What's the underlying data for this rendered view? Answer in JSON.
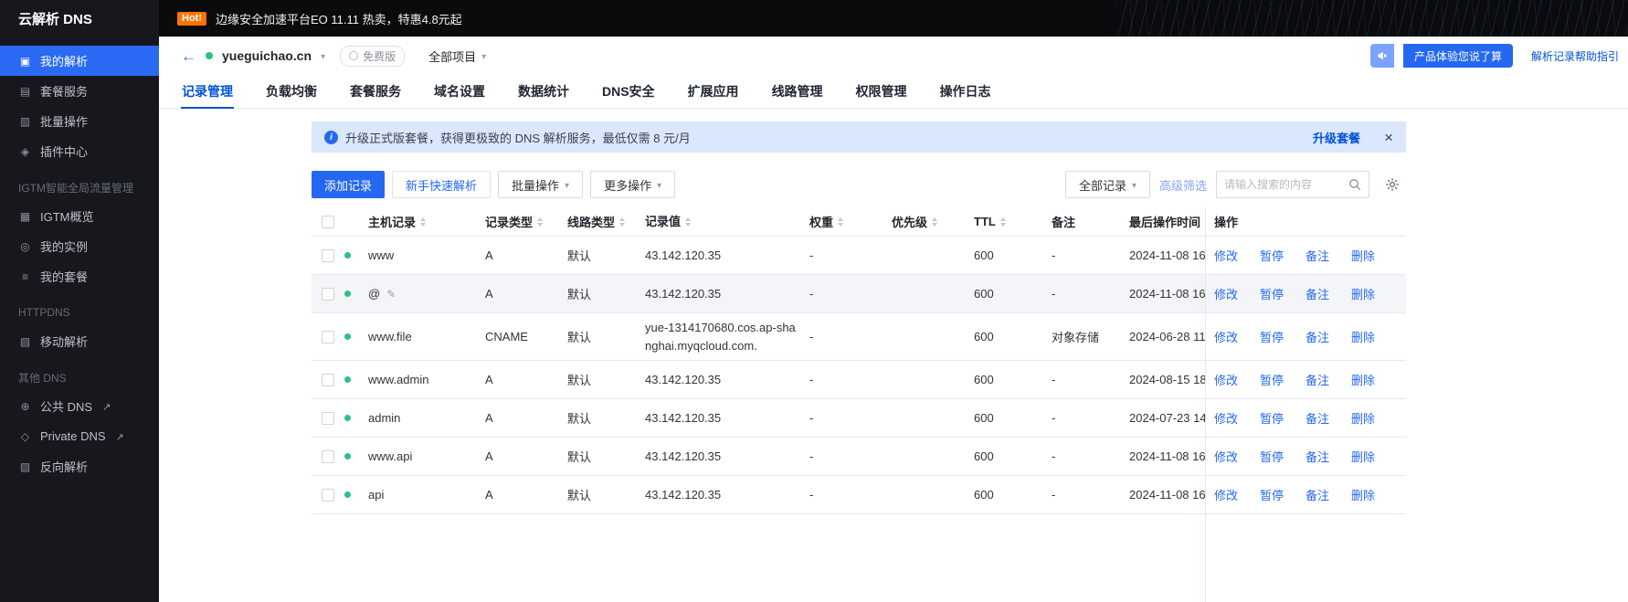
{
  "colors": {
    "accent": "#2468f2",
    "accent_dark": "#0052d9",
    "sidebar_bg": "#17181d",
    "topbar_bg": "#0a0b0d",
    "hot_badge": "#ff7200",
    "banner_bg": "#dbe7fc",
    "status_green": "#2bc27d",
    "hover_row": "#f3f5f8",
    "border": "#e8eaee"
  },
  "sidebar": {
    "title": "云解析 DNS",
    "items": [
      {
        "label": "我的解析",
        "icon": "monitor",
        "active": true
      },
      {
        "label": "套餐服务",
        "icon": "package"
      },
      {
        "label": "批量操作",
        "icon": "batch"
      },
      {
        "label": "插件中心",
        "icon": "plugin"
      },
      {
        "label": "IGTM智能全局流量管理",
        "section": true
      },
      {
        "label": "IGTM概览",
        "icon": "overview"
      },
      {
        "label": "我的实例",
        "icon": "instance"
      },
      {
        "label": "我的套餐",
        "icon": "plan"
      },
      {
        "label": "HTTPDNS",
        "section": true
      },
      {
        "label": "移动解析",
        "icon": "mobile"
      },
      {
        "label": "其他 DNS",
        "section": true
      },
      {
        "label": "公共 DNS",
        "icon": "globe",
        "external": true
      },
      {
        "label": "Private DNS",
        "icon": "private",
        "external": true
      },
      {
        "label": "反向解析",
        "icon": "reverse"
      }
    ]
  },
  "topbar": {
    "hot_badge": "Hot!",
    "promo_text": "边缘安全加速平台EO 11.11 热卖，特惠4.8元起"
  },
  "header": {
    "domain": "yueguichao.cn",
    "plan_badge": "免费版",
    "project_selector": "全部项目",
    "feedback_button": "产品体验您说了算",
    "help_link": "解析记录帮助指引"
  },
  "tabs": [
    {
      "label": "记录管理",
      "active": true
    },
    {
      "label": "负载均衡"
    },
    {
      "label": "套餐服务"
    },
    {
      "label": "域名设置"
    },
    {
      "label": "数据统计"
    },
    {
      "label": "DNS安全"
    },
    {
      "label": "扩展应用"
    },
    {
      "label": "线路管理"
    },
    {
      "label": "权限管理"
    },
    {
      "label": "操作日志"
    }
  ],
  "banner": {
    "text": "升级正式版套餐，获得更极致的 DNS 解析服务，最低仅需 8 元/月",
    "action": "升级套餐"
  },
  "toolbar": {
    "add_record": "添加记录",
    "quick_setup": "新手快速解析",
    "batch_ops": "批量操作",
    "more_ops": "更多操作",
    "filter_all": "全部记录",
    "advanced_filter": "高级筛选",
    "search_placeholder": "请输入搜索的内容"
  },
  "table": {
    "columns": [
      {
        "label": "主机记录",
        "sortable": true
      },
      {
        "label": "记录类型",
        "sortable": true
      },
      {
        "label": "线路类型",
        "sortable": true
      },
      {
        "label": "记录值",
        "sortable": true
      },
      {
        "label": "权重",
        "sortable": true
      },
      {
        "label": "优先级",
        "sortable": true
      },
      {
        "label": "TTL",
        "sortable": true
      },
      {
        "label": "备注",
        "sortable": false
      },
      {
        "label": "最后操作时间",
        "sortable": true
      },
      {
        "label": "操作",
        "sortable": false
      }
    ],
    "actions": [
      "修改",
      "暂停",
      "备注",
      "删除"
    ],
    "rows": [
      {
        "status": "enabled",
        "host": "www",
        "type": "A",
        "line": "默认",
        "value": "43.142.120.35",
        "weight": "-",
        "priority": "",
        "ttl": "600",
        "remark": "-",
        "updated": "2024-11-08 16:"
      },
      {
        "status": "enabled",
        "host": "@",
        "editable": true,
        "hover": true,
        "type": "A",
        "line": "默认",
        "value": "43.142.120.35",
        "weight": "-",
        "priority": "",
        "ttl": "600",
        "remark": "-",
        "updated": "2024-11-08 16:"
      },
      {
        "status": "enabled",
        "host": "www.file",
        "type": "CNAME",
        "line": "默认",
        "value": "yue-1314170680.cos.ap-shanghai.myqcloud.com.",
        "weight": "-",
        "priority": "",
        "ttl": "600",
        "remark": "对象存储",
        "updated": "2024-06-28 11:"
      },
      {
        "status": "enabled",
        "host": "www.admin",
        "type": "A",
        "line": "默认",
        "value": "43.142.120.35",
        "weight": "-",
        "priority": "",
        "ttl": "600",
        "remark": "-",
        "updated": "2024-08-15 18:"
      },
      {
        "status": "enabled",
        "host": "admin",
        "type": "A",
        "line": "默认",
        "value": "43.142.120.35",
        "weight": "-",
        "priority": "",
        "ttl": "600",
        "remark": "-",
        "updated": "2024-07-23 14:"
      },
      {
        "status": "enabled",
        "host": "www.api",
        "type": "A",
        "line": "默认",
        "value": "43.142.120.35",
        "weight": "-",
        "priority": "",
        "ttl": "600",
        "remark": "-",
        "updated": "2024-11-08 16:"
      },
      {
        "status": "enabled",
        "host": "api",
        "type": "A",
        "line": "默认",
        "value": "43.142.120.35",
        "weight": "-",
        "priority": "",
        "ttl": "600",
        "remark": "-",
        "updated": "2024-11-08 16:"
      }
    ]
  }
}
